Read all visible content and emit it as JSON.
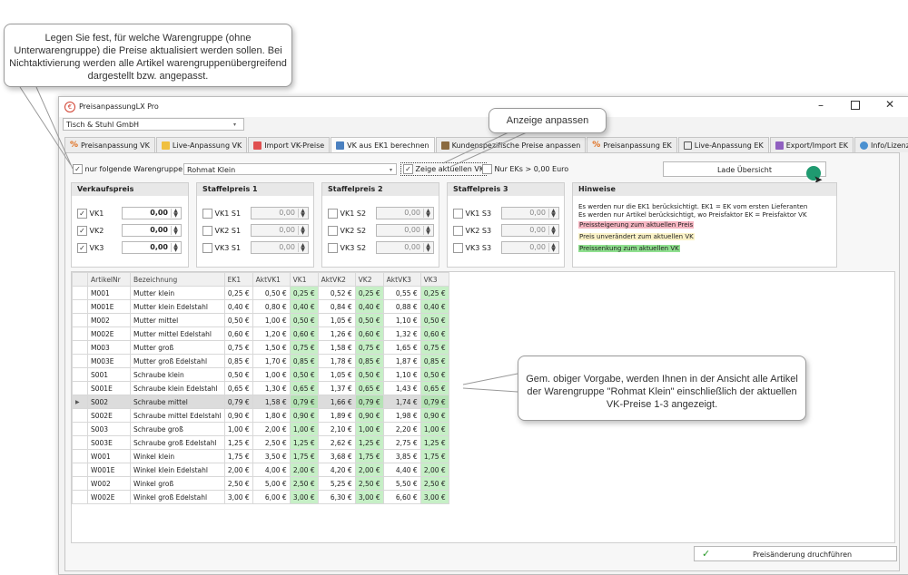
{
  "callouts": {
    "top_left": "Legen Sie fest, für welche Warengruppe (ohne Unterwarengruppe) die Preise aktualisiert werden sollen. Bei Nichtaktivierung werden alle Artikel warengruppenübergreifend dargestellt bzw. angepasst.",
    "anzeige": "Anzeige anpassen",
    "grid": "Gem. obiger Vorgabe, werden Ihnen in der Ansicht alle Artikel der Warengruppe \"Rohmat Klein\" einschließlich der aktuellen VK-Preise 1-3 angezeigt."
  },
  "window": {
    "title": "PreisanpassungLX Pro",
    "company": "Tisch & Stuhl GmbH"
  },
  "tabs": [
    {
      "label": "Preisanpassung VK",
      "icon": "percent-icon"
    },
    {
      "label": "Live-Anpassung VK",
      "icon": "pencil-icon"
    },
    {
      "label": "Import VK-Preise",
      "icon": "import-icon"
    },
    {
      "label": "VK aus EK1 berechnen",
      "icon": "calculator-icon"
    },
    {
      "label": "Kundenspezifische Preise anpassen",
      "icon": "customer-icon"
    },
    {
      "label": "Preisanpassung EK",
      "icon": "percent-icon"
    },
    {
      "label": "Live-Anpassung EK",
      "icon": "table-icon"
    },
    {
      "label": "Export/Import EK",
      "icon": "export-icon"
    },
    {
      "label": "Info/Lizenz",
      "icon": "info-icon"
    }
  ],
  "filter": {
    "nur_folgende_label": "nur folgende Warengruppe",
    "warengruppe": "Rohmat Klein",
    "zeige_label": "Zeige aktuellen VK",
    "nur_eks_label": "Nur EKs > 0,00 Euro",
    "lade_label": "Lade Übersicht"
  },
  "groups": {
    "verkaufspreis": {
      "title": "Verkaufspreis",
      "items": [
        {
          "label": "VK1",
          "value": "0,00"
        },
        {
          "label": "VK2",
          "value": "0,00"
        },
        {
          "label": "VK3",
          "value": "0,00"
        }
      ]
    },
    "staffel1": {
      "title": "Staffelpreis 1",
      "items": [
        {
          "label": "VK1 S1",
          "value": "0,00"
        },
        {
          "label": "VK2 S1",
          "value": "0,00"
        },
        {
          "label": "VK3 S1",
          "value": "0,00"
        }
      ]
    },
    "staffel2": {
      "title": "Staffelpreis 2",
      "items": [
        {
          "label": "VK1 S2",
          "value": "0,00"
        },
        {
          "label": "VK2 S2",
          "value": "0,00"
        },
        {
          "label": "VK3 S2",
          "value": "0,00"
        }
      ]
    },
    "staffel3": {
      "title": "Staffelpreis 3",
      "items": [
        {
          "label": "VK1 S3",
          "value": "0,00"
        },
        {
          "label": "VK2 S3",
          "value": "0,00"
        },
        {
          "label": "VK3 S3",
          "value": "0,00"
        }
      ]
    }
  },
  "hinweise": {
    "title": "Hinweise",
    "line1": "Es werden nur die EK1 berücksichtigt. EK1 = EK vom ersten Lieferanten",
    "line2": "Es werden nur Artikel berücksichtigt, wo Preisfaktor EK = Preisfaktor VK",
    "legend_up": "Preissteigerung zum aktuellen Preis",
    "legend_same": "Preis unverändert zum aktuellen VK",
    "legend_down": "Preissenkung zum aktuellen VK",
    "colors": {
      "up": "#f7b6c2",
      "same": "#fbf3c8",
      "down": "#8fe08f"
    }
  },
  "table": {
    "columns": [
      "ArtikelNr",
      "Bezeichnung",
      "EK1",
      "AktVK1",
      "VK1",
      "AktVK2",
      "VK2",
      "AktVK3",
      "VK3"
    ],
    "rows": [
      [
        "M001",
        "Mutter klein",
        "0,25 €",
        "0,50 €",
        "0,25 €",
        "0,52 €",
        "0,25 €",
        "0,55 €",
        "0,25 €"
      ],
      [
        "M001E",
        "Mutter klein Edelstahl",
        "0,40 €",
        "0,80 €",
        "0,40 €",
        "0,84 €",
        "0,40 €",
        "0,88 €",
        "0,40 €"
      ],
      [
        "M002",
        "Mutter mittel",
        "0,50 €",
        "1,00 €",
        "0,50 €",
        "1,05 €",
        "0,50 €",
        "1,10 €",
        "0,50 €"
      ],
      [
        "M002E",
        "Mutter mittel Edelstahl",
        "0,60 €",
        "1,20 €",
        "0,60 €",
        "1,26 €",
        "0,60 €",
        "1,32 €",
        "0,60 €"
      ],
      [
        "M003",
        "Mutter groß",
        "0,75 €",
        "1,50 €",
        "0,75 €",
        "1,58 €",
        "0,75 €",
        "1,65 €",
        "0,75 €"
      ],
      [
        "M003E",
        "Mutter groß Edelstahl",
        "0,85 €",
        "1,70 €",
        "0,85 €",
        "1,78 €",
        "0,85 €",
        "1,87 €",
        "0,85 €"
      ],
      [
        "S001",
        "Schraube klein",
        "0,50 €",
        "1,00 €",
        "0,50 €",
        "1,05 €",
        "0,50 €",
        "1,10 €",
        "0,50 €"
      ],
      [
        "S001E",
        "Schraube klein Edelstahl",
        "0,65 €",
        "1,30 €",
        "0,65 €",
        "1,37 €",
        "0,65 €",
        "1,43 €",
        "0,65 €"
      ],
      [
        "S002",
        "Schraube mittel",
        "0,79 €",
        "1,58 €",
        "0,79 €",
        "1,66 €",
        "0,79 €",
        "1,74 €",
        "0,79 €"
      ],
      [
        "S002E",
        "Schraube mittel Edelstahl",
        "0,90 €",
        "1,80 €",
        "0,90 €",
        "1,89 €",
        "0,90 €",
        "1,98 €",
        "0,90 €"
      ],
      [
        "S003",
        "Schraube groß",
        "1,00 €",
        "2,00 €",
        "1,00 €",
        "2,10 €",
        "1,00 €",
        "2,20 €",
        "1,00 €"
      ],
      [
        "S003E",
        "Schraube groß Edelstahl",
        "1,25 €",
        "2,50 €",
        "1,25 €",
        "2,62 €",
        "1,25 €",
        "2,75 €",
        "1,25 €"
      ],
      [
        "W001",
        "Winkel klein",
        "1,75 €",
        "3,50 €",
        "1,75 €",
        "3,68 €",
        "1,75 €",
        "3,85 €",
        "1,75 €"
      ],
      [
        "W001E",
        "Winkel klein Edelstahl",
        "2,00 €",
        "4,00 €",
        "2,00 €",
        "4,20 €",
        "2,00 €",
        "4,40 €",
        "2,00 €"
      ],
      [
        "W002",
        "Winkel groß",
        "2,50 €",
        "5,00 €",
        "2,50 €",
        "5,25 €",
        "2,50 €",
        "5,50 €",
        "2,50 €"
      ],
      [
        "W002E",
        "Winkel groß Edelstahl",
        "3,00 €",
        "6,00 €",
        "3,00 €",
        "6,30 €",
        "3,00 €",
        "6,60 €",
        "3,00 €"
      ]
    ],
    "selected_row": 8
  },
  "footer": {
    "apply_label": "Preisänderung druchführen"
  }
}
